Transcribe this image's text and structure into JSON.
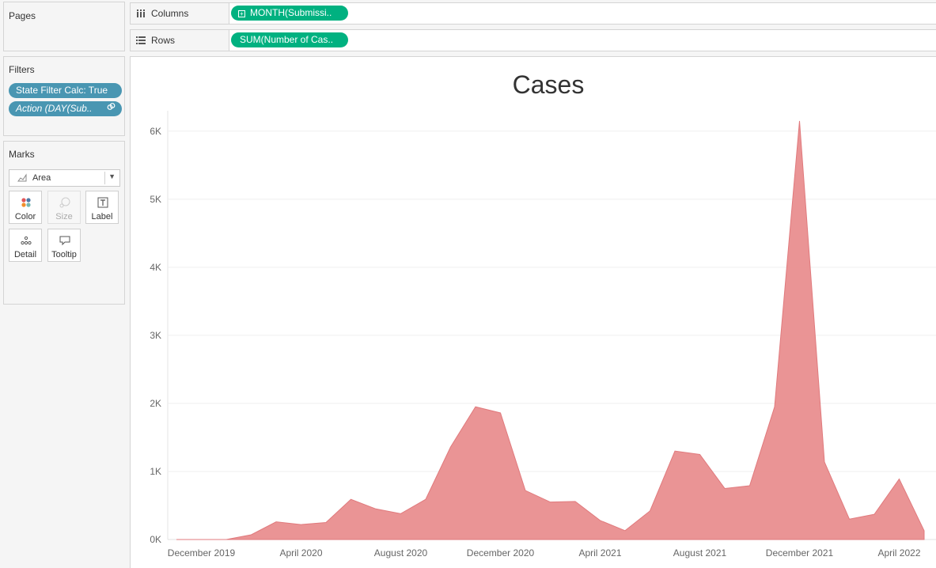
{
  "cards": {
    "pages": {
      "title": "Pages"
    },
    "filters": {
      "title": "Filters",
      "pills": [
        {
          "label": "State Filter Calc: True"
        },
        {
          "label": "Action (DAY(Sub..",
          "icon": "link-icon"
        }
      ]
    },
    "marks": {
      "title": "Marks",
      "mark_type": "Area",
      "buttons": [
        {
          "label": "Color",
          "icon": "color-dots-icon",
          "enabled": true
        },
        {
          "label": "Size",
          "icon": "size-icon",
          "enabled": false
        },
        {
          "label": "Label",
          "icon": "text-label-icon",
          "enabled": true
        },
        {
          "label": "Detail",
          "icon": "detail-dots-icon",
          "enabled": true
        },
        {
          "label": "Tooltip",
          "icon": "tooltip-icon",
          "enabled": true
        }
      ]
    }
  },
  "shelves": {
    "columns": {
      "label": "Columns",
      "pill": "MONTH(Submissi.."
    },
    "rows": {
      "label": "Rows",
      "pill": "SUM(Number of Cas.."
    }
  },
  "colors": {
    "filter_pill": "#4996b2",
    "field_pill": "#00b180",
    "area_fill": "#e8888a"
  },
  "chart_data": {
    "type": "area",
    "title": "Cases",
    "xlabel": "",
    "ylabel": "",
    "x": [
      "2019-11",
      "2019-12",
      "2020-01",
      "2020-02",
      "2020-03",
      "2020-04",
      "2020-05",
      "2020-06",
      "2020-07",
      "2020-08",
      "2020-09",
      "2020-10",
      "2020-11",
      "2020-12",
      "2021-01",
      "2021-02",
      "2021-03",
      "2021-04",
      "2021-05",
      "2021-06",
      "2021-07",
      "2021-08",
      "2021-09",
      "2021-10",
      "2021-11",
      "2021-12",
      "2021-13",
      "2021-14",
      "2022-03",
      "2022-04",
      "2022-05",
      "2022-06"
    ],
    "x_ticks": [
      "December 2019",
      "April 2020",
      "August 2020",
      "December 2020",
      "April 2021",
      "August 2021",
      "December 2021",
      "April 2022"
    ],
    "y_ticks": [
      "0K",
      "1K",
      "2K",
      "3K",
      "4K",
      "5K",
      "6K"
    ],
    "ylim": [
      0,
      6300
    ],
    "grid": "horizontal",
    "series": [
      {
        "values": [
          0,
          0,
          0,
          70,
          260,
          220,
          250,
          590,
          450,
          380,
          590,
          1360,
          1950,
          1860,
          720,
          550,
          560,
          280,
          130,
          420,
          1300,
          1250,
          750,
          790,
          1950,
          6150,
          1140,
          300,
          370,
          890,
          130
        ]
      }
    ],
    "legend": "none"
  }
}
